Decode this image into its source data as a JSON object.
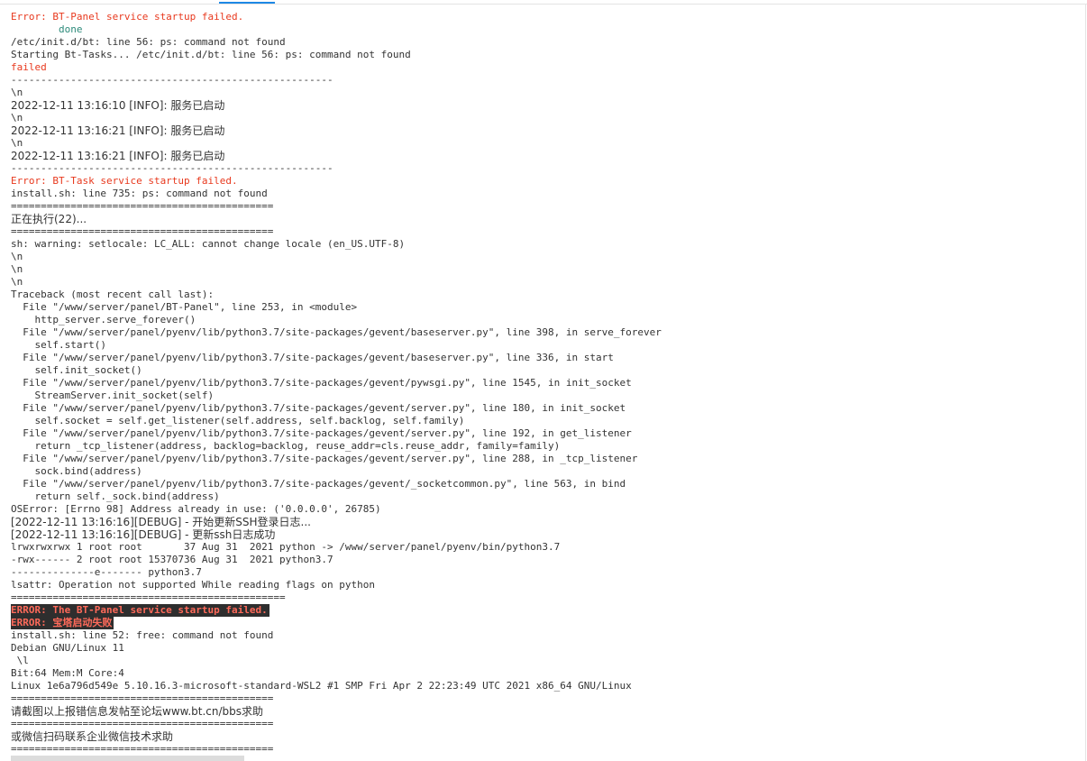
{
  "colors": {
    "accent": "#1e88e5",
    "error_text": "#e8391e",
    "success_text": "#2c8a7a",
    "highlight_bg": "#2e2e2e",
    "highlight_fg": "#ff6a5a"
  },
  "log": {
    "lines": [
      {
        "text": "Error: BT-Panel service startup failed.",
        "style": "err"
      },
      {
        "text": "        done",
        "style": "ok"
      },
      {
        "text": "/etc/init.d/bt: line 56: ps: command not found",
        "style": ""
      },
      {
        "text": "Starting Bt-Tasks... /etc/init.d/bt: line 56: ps: command not found",
        "style": ""
      },
      {
        "text": "failed",
        "style": "err"
      },
      {
        "text": "------------------------------------------------------",
        "style": ""
      },
      {
        "text": "\\n",
        "style": ""
      },
      {
        "text": "2022-12-11 13:16:10 [INFO]: 服务已启动",
        "style": "cjk"
      },
      {
        "text": "\\n",
        "style": ""
      },
      {
        "text": "2022-12-11 13:16:21 [INFO]: 服务已启动",
        "style": "cjk"
      },
      {
        "text": "\\n",
        "style": ""
      },
      {
        "text": "2022-12-11 13:16:21 [INFO]: 服务已启动",
        "style": "cjk"
      },
      {
        "text": "------------------------------------------------------",
        "style": ""
      },
      {
        "text": "Error: BT-Task service startup failed.",
        "style": "err"
      },
      {
        "text": "install.sh: line 735: ps: command not found",
        "style": ""
      },
      {
        "text": "============================================",
        "style": ""
      },
      {
        "text": "正在执行(22)...",
        "style": "cjk"
      },
      {
        "text": "============================================",
        "style": ""
      },
      {
        "text": "sh: warning: setlocale: LC_ALL: cannot change locale (en_US.UTF-8)",
        "style": ""
      },
      {
        "text": "\\n",
        "style": ""
      },
      {
        "text": "\\n",
        "style": ""
      },
      {
        "text": "\\n",
        "style": ""
      },
      {
        "text": "Traceback (most recent call last):",
        "style": ""
      },
      {
        "text": "  File \"/www/server/panel/BT-Panel\", line 253, in <module>",
        "style": ""
      },
      {
        "text": "    http_server.serve_forever()",
        "style": ""
      },
      {
        "text": "  File \"/www/server/panel/pyenv/lib/python3.7/site-packages/gevent/baseserver.py\", line 398, in serve_forever",
        "style": ""
      },
      {
        "text": "    self.start()",
        "style": ""
      },
      {
        "text": "  File \"/www/server/panel/pyenv/lib/python3.7/site-packages/gevent/baseserver.py\", line 336, in start",
        "style": ""
      },
      {
        "text": "    self.init_socket()",
        "style": ""
      },
      {
        "text": "  File \"/www/server/panel/pyenv/lib/python3.7/site-packages/gevent/pywsgi.py\", line 1545, in init_socket",
        "style": ""
      },
      {
        "text": "    StreamServer.init_socket(self)",
        "style": ""
      },
      {
        "text": "  File \"/www/server/panel/pyenv/lib/python3.7/site-packages/gevent/server.py\", line 180, in init_socket",
        "style": ""
      },
      {
        "text": "    self.socket = self.get_listener(self.address, self.backlog, self.family)",
        "style": ""
      },
      {
        "text": "  File \"/www/server/panel/pyenv/lib/python3.7/site-packages/gevent/server.py\", line 192, in get_listener",
        "style": ""
      },
      {
        "text": "    return _tcp_listener(address, backlog=backlog, reuse_addr=cls.reuse_addr, family=family)",
        "style": ""
      },
      {
        "text": "  File \"/www/server/panel/pyenv/lib/python3.7/site-packages/gevent/server.py\", line 288, in _tcp_listener",
        "style": ""
      },
      {
        "text": "    sock.bind(address)",
        "style": ""
      },
      {
        "text": "  File \"/www/server/panel/pyenv/lib/python3.7/site-packages/gevent/_socketcommon.py\", line 563, in bind",
        "style": ""
      },
      {
        "text": "    return self._sock.bind(address)",
        "style": ""
      },
      {
        "text": "OSError: [Errno 98] Address already in use: ('0.0.0.0', 26785)",
        "style": ""
      },
      {
        "text": "[2022-12-11 13:16:16][DEBUG] - 开始更新SSH登录日志...",
        "style": "cjk"
      },
      {
        "text": "[2022-12-11 13:16:16][DEBUG] - 更新ssh日志成功",
        "style": "cjk"
      },
      {
        "text": "lrwxrwxrwx 1 root root       37 Aug 31  2021 python -> /www/server/panel/pyenv/bin/python3.7",
        "style": ""
      },
      {
        "text": "-rwx------ 2 root root 15370736 Aug 31  2021 python3.7",
        "style": ""
      },
      {
        "text": "--------------e------- python3.7",
        "style": ""
      },
      {
        "text": "lsattr: Operation not supported While reading flags on python",
        "style": ""
      },
      {
        "text": "==============================================",
        "style": ""
      },
      {
        "text": "ERROR: The BT-Panel service startup failed.",
        "style": "hl"
      },
      {
        "text": "ERROR: 宝塔启动失败",
        "style": "hl"
      },
      {
        "text": "install.sh: line 52: free: command not found",
        "style": ""
      },
      {
        "text": "Debian GNU/Linux 11",
        "style": ""
      },
      {
        "text": " \\l",
        "style": ""
      },
      {
        "text": "Bit:64 Mem:M Core:4",
        "style": ""
      },
      {
        "text": "Linux 1e6a796d549e 5.10.16.3-microsoft-standard-WSL2 #1 SMP Fri Apr 2 22:23:49 UTC 2021 x86_64 GNU/Linux",
        "style": ""
      },
      {
        "text": "============================================",
        "style": ""
      },
      {
        "text": "请截图以上报错信息发帖至论坛www.bt.cn/bbs求助",
        "style": "cjk"
      },
      {
        "text": "============================================",
        "style": ""
      },
      {
        "text": "或微信扫码联系企业微信技术求助",
        "style": "cjk"
      },
      {
        "text": "============================================",
        "style": ""
      }
    ]
  }
}
